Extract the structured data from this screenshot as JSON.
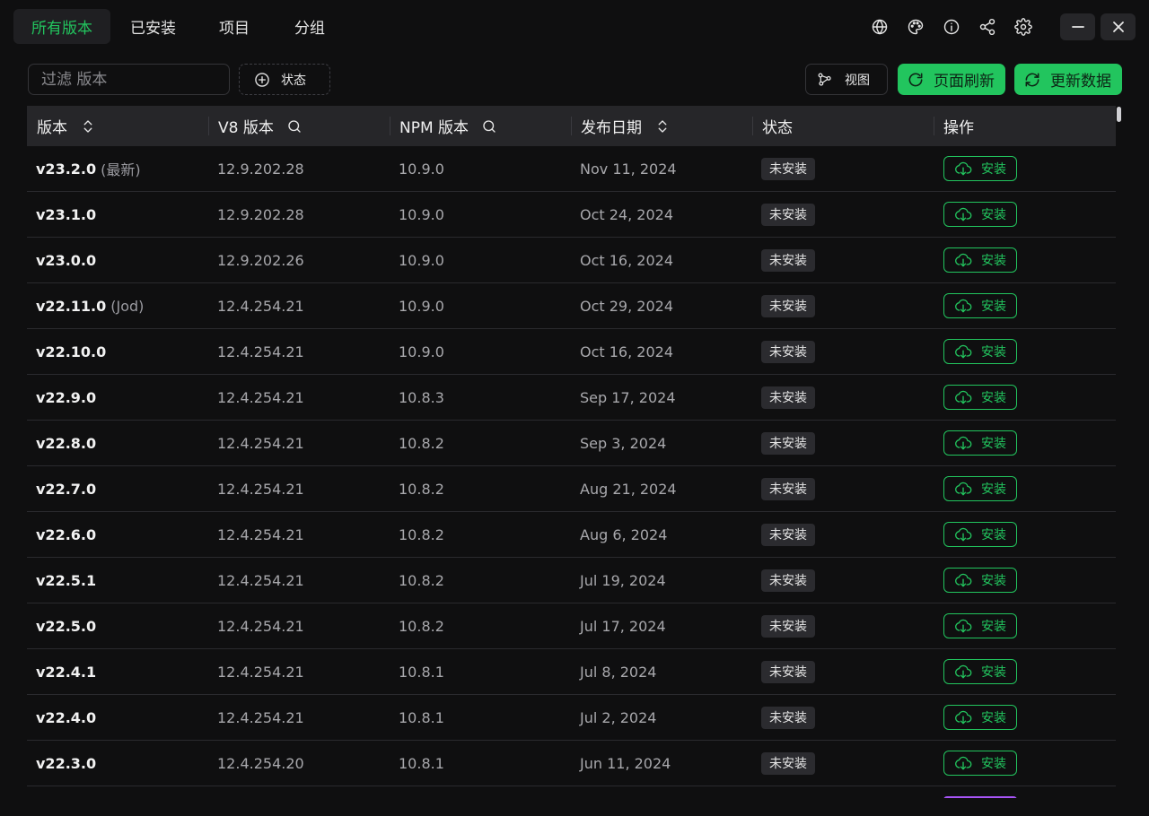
{
  "nav": {
    "tabs": [
      {
        "label": "所有版本",
        "active": true
      },
      {
        "label": "已安装",
        "active": false
      },
      {
        "label": "项目",
        "active": false
      },
      {
        "label": "分组",
        "active": false
      }
    ],
    "icons": [
      "globe-icon",
      "palette-icon",
      "info-icon",
      "share-icon",
      "gear-icon"
    ]
  },
  "toolbar": {
    "filter_placeholder": "过滤 版本",
    "filter_value": "",
    "status_label": "状态",
    "view_label": "视图",
    "refresh_page_label": "页面刷新",
    "update_data_label": "更新数据"
  },
  "table": {
    "columns": [
      "版本",
      "V8 版本",
      "NPM 版本",
      "发布日期",
      "状态",
      "操作"
    ],
    "install_label": "安装",
    "rows": [
      {
        "version": "v23.2.0",
        "tag": "(最新)",
        "v8": "12.9.202.28",
        "npm": "10.9.0",
        "date": "Nov 11, 2024",
        "status": "未安装"
      },
      {
        "version": "v23.1.0",
        "tag": "",
        "v8": "12.9.202.28",
        "npm": "10.9.0",
        "date": "Oct 24, 2024",
        "status": "未安装"
      },
      {
        "version": "v23.0.0",
        "tag": "",
        "v8": "12.9.202.26",
        "npm": "10.9.0",
        "date": "Oct 16, 2024",
        "status": "未安装"
      },
      {
        "version": "v22.11.0",
        "tag": "(Jod)",
        "v8": "12.4.254.21",
        "npm": "10.9.0",
        "date": "Oct 29, 2024",
        "status": "未安装"
      },
      {
        "version": "v22.10.0",
        "tag": "",
        "v8": "12.4.254.21",
        "npm": "10.9.0",
        "date": "Oct 16, 2024",
        "status": "未安装"
      },
      {
        "version": "v22.9.0",
        "tag": "",
        "v8": "12.4.254.21",
        "npm": "10.8.3",
        "date": "Sep 17, 2024",
        "status": "未安装"
      },
      {
        "version": "v22.8.0",
        "tag": "",
        "v8": "12.4.254.21",
        "npm": "10.8.2",
        "date": "Sep 3, 2024",
        "status": "未安装"
      },
      {
        "version": "v22.7.0",
        "tag": "",
        "v8": "12.4.254.21",
        "npm": "10.8.2",
        "date": "Aug 21, 2024",
        "status": "未安装"
      },
      {
        "version": "v22.6.0",
        "tag": "",
        "v8": "12.4.254.21",
        "npm": "10.8.2",
        "date": "Aug 6, 2024",
        "status": "未安装"
      },
      {
        "version": "v22.5.1",
        "tag": "",
        "v8": "12.4.254.21",
        "npm": "10.8.2",
        "date": "Jul 19, 2024",
        "status": "未安装"
      },
      {
        "version": "v22.5.0",
        "tag": "",
        "v8": "12.4.254.21",
        "npm": "10.8.2",
        "date": "Jul 17, 2024",
        "status": "未安装"
      },
      {
        "version": "v22.4.1",
        "tag": "",
        "v8": "12.4.254.21",
        "npm": "10.8.1",
        "date": "Jul 8, 2024",
        "status": "未安装"
      },
      {
        "version": "v22.4.0",
        "tag": "",
        "v8": "12.4.254.21",
        "npm": "10.8.1",
        "date": "Jul 2, 2024",
        "status": "未安装"
      },
      {
        "version": "v22.3.0",
        "tag": "",
        "v8": "12.4.254.20",
        "npm": "10.8.1",
        "date": "Jun 11, 2024",
        "status": "未安装"
      }
    ]
  },
  "colors": {
    "accent": "#22c55e",
    "background": "#0f0f10",
    "header_bg": "#262629",
    "partial_accent": "#a855f7"
  }
}
